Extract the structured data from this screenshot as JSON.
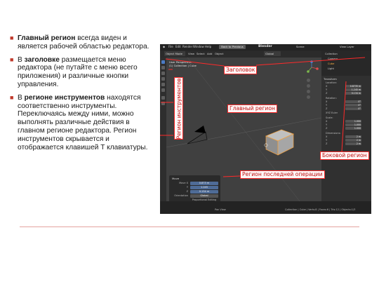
{
  "bullets": [
    {
      "bold": "Главный регион",
      "text": " всегда виден и является рабочей областью редактора."
    },
    {
      "lead": "В ",
      "bold": "заголовке",
      "text": " размещается меню редактора (не путайте с меню всего приложения) и различные кнопки управления."
    },
    {
      "lead": "В ",
      "bold": "регионе инструментов",
      "text": " находятся соответственно инструменты. Переключаясь между ними, можно выполнять различные действия в главном регионе редактора. Регион инструментов скрывается и отображается клавишей T клавиатуры."
    }
  ],
  "screenshot": {
    "app_title": "Blender",
    "menu": [
      "File",
      "Edit",
      "Render",
      "Window",
      "Help"
    ],
    "workspace_tab": "Back to Previous",
    "scene": "Scene",
    "view_layer": "View Layer",
    "header_items": [
      "Object Mode",
      "View",
      "Select",
      "Add",
      "Object"
    ],
    "transform_orientation": "Global",
    "viewport_info": [
      "User Perspective",
      "(1) Collection | Cube"
    ],
    "operator_panel": {
      "title": "Move",
      "rows": [
        {
          "label": "Move X",
          "value": "0.873 m"
        },
        {
          "label": "Y",
          "value": "1.245"
        },
        {
          "label": "Z",
          "value": "0.134 m"
        },
        {
          "label": "Orientation",
          "value": "Global"
        },
        {
          "label": "",
          "value": "Proportional Editing"
        }
      ]
    },
    "outliner_items": [
      "Collection",
      "Camera",
      "Cube",
      "Light"
    ],
    "sidebar": {
      "section_transform": "Transform",
      "location_label": "Location:",
      "location": [
        {
          "axis": "X",
          "value": "0.8735 m"
        },
        {
          "axis": "Y",
          "value": "1.245 m"
        },
        {
          "axis": "Z",
          "value": "0.134 m"
        }
      ],
      "rotation_label": "Rotation:",
      "rotation": [
        {
          "axis": "X",
          "value": "0°"
        },
        {
          "axis": "Y",
          "value": "0°"
        },
        {
          "axis": "Z",
          "value": "0°"
        }
      ],
      "mode_label": "XYZ Euler",
      "scale_label": "Scale:",
      "scale": [
        {
          "axis": "X",
          "value": "1.000"
        },
        {
          "axis": "Y",
          "value": "1.000"
        },
        {
          "axis": "Z",
          "value": "1.000"
        }
      ],
      "dimensions_label": "Dimensions:",
      "dimensions": [
        {
          "axis": "X",
          "value": "2 m"
        },
        {
          "axis": "Y",
          "value": "2 m"
        },
        {
          "axis": "Z",
          "value": "2 m"
        }
      ]
    },
    "status_left": "Pan View",
    "status_right": "Collection | Cube | Verts:8 | Faces:6 | Tris:12 | Objects:1/3"
  },
  "callouts": {
    "header": "Заголовок",
    "main": "Главный регион",
    "tools": "Регион инструментов",
    "sidebar": "Боковой регион",
    "last_op": "Регион последней операции"
  },
  "colors": {
    "callout_border": "#ff2a2a",
    "callout_text": "#c21212",
    "bullet_marker": "#c0392b",
    "accent_blue": "#4b7bc4"
  }
}
